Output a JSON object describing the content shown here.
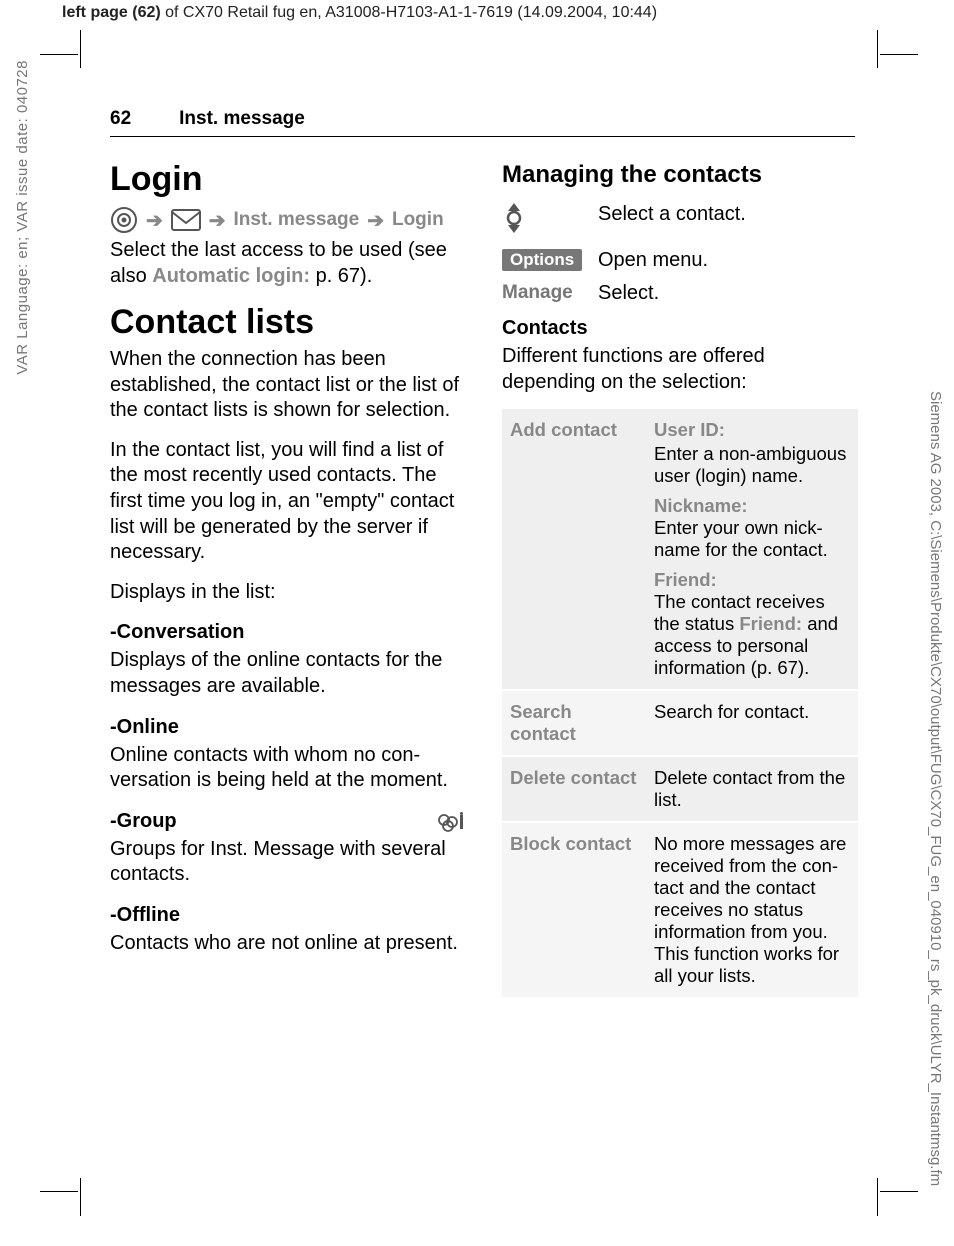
{
  "meta": {
    "top_header_bold": "left page (62)",
    "top_header_rest": " of CX70 Retail fug en, A31008-H7103-A1-1-7619 (14.09.2004, 10:44)",
    "side_left": "VAR Language: en; VAR issue date: 040728",
    "side_right": "Siemens AG 2003, C:\\Siemens\\Produkte\\CX70\\output\\FUG\\CX70_FUG_en_040910_rs_pk_druck\\ULYR_Instantmsg.fm"
  },
  "header": {
    "page_number": "62",
    "running_title": "Inst. message"
  },
  "left": {
    "h_login": "Login",
    "nav_inst": "Inst. message",
    "nav_login": "Login",
    "login_p1a": "Select the last access to be used (see also ",
    "login_p1b": "Automatic login:",
    "login_p1c": " p. 67).",
    "h_contact_lists": "Contact lists",
    "cl_p1": "When the connection has been established, the contact list or the list of the contact lists is shown for selection.",
    "cl_p2": "In the contact list, you will find a list of the most recently used contacts. The first time you log in, an \"empty\" contact list will be generated by the server if necessary.",
    "cl_p3": "Displays in the list:",
    "h_conv": "-Conversation",
    "conv_p": "Displays of the online contacts for the messages are available.",
    "h_online": "-Online",
    "online_p": "Online contacts with whom no con­versation is being held at the moment.",
    "h_group": "-Group",
    "group_p": "Groups for Inst. Message with sev­eral contacts.",
    "h_offline": "-Offline",
    "offline_p": "Contacts who are not online at present."
  },
  "right": {
    "h_manage": "Managing the contacts",
    "step_select": "Select a contact.",
    "step_options_key": "Options",
    "step_options_val": "Open menu.",
    "step_manage_key": "Manage",
    "step_manage_val": "Select.",
    "h_contacts": "Contacts",
    "contacts_intro": "Different functions are offered depending on the selection:",
    "table": {
      "add": {
        "label": "Add contact",
        "userid_h": "User ID:",
        "userid_t": "Enter a non-ambiguous user (login) name.",
        "nick_h": "Nickname:",
        "nick_t": "Enter your own nick­name for the contact.",
        "friend_h": "Friend:",
        "friend_t1": "The contact receives the status ",
        "friend_t2": "Friend:",
        "friend_t3": " and access to personal infor­mation (p. 67)."
      },
      "search": {
        "label": "Search contact",
        "text": "Search for contact."
      },
      "delete": {
        "label": "Delete contact",
        "text": "Delete contact from the list."
      },
      "block": {
        "label": "Block contact",
        "text": "No more messages are received from the con­tact and the contact receives no status infor­mation from you. This function works for all your lists."
      }
    }
  }
}
